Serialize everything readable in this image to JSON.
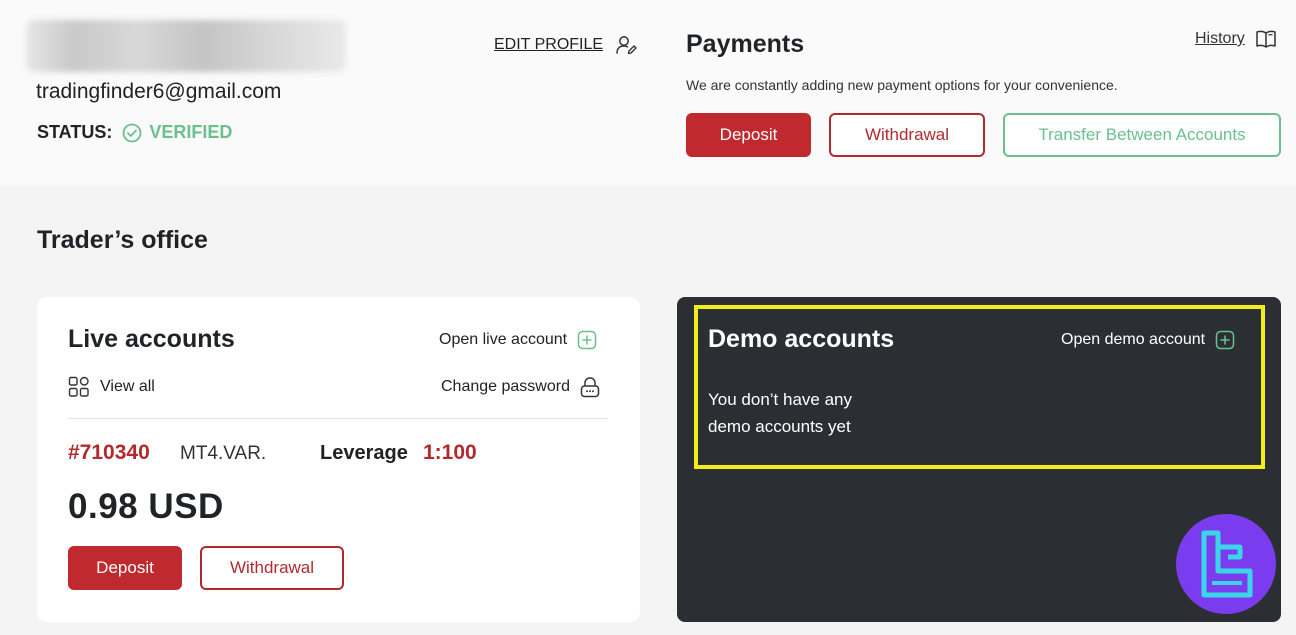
{
  "profile": {
    "email": "tradingfinder6@gmail.com",
    "status_label": "STATUS:",
    "status_value": "VERIFIED",
    "edit_profile": "EDIT PROFILE"
  },
  "payments": {
    "title": "Payments",
    "subtitle": "We are constantly adding new payment options for your convenience.",
    "history": "History",
    "deposit": "Deposit",
    "withdrawal": "Withdrawal",
    "transfer": "Transfer Between Accounts"
  },
  "office": {
    "title": "Trader’s office"
  },
  "live": {
    "title": "Live accounts",
    "open": "Open live account",
    "view_all": "View all",
    "change_password": "Change password",
    "account_id": "#710340",
    "account_type": "MT4.VAR.",
    "leverage_label": "Leverage",
    "leverage_value": "1:100",
    "balance": "0.98 USD",
    "deposit": "Deposit",
    "withdrawal": "Withdrawal"
  },
  "demo": {
    "title": "Demo accounts",
    "open": "Open demo account",
    "empty_line1": "You don’t have any",
    "empty_line2": "demo accounts yet"
  },
  "colors": {
    "brand_red": "#c0292e",
    "verified_green": "#6cc08f",
    "dark_card": "#2b2f33",
    "highlight_yellow": "#f5ec1a",
    "logo_purple": "#7b3cf0"
  }
}
